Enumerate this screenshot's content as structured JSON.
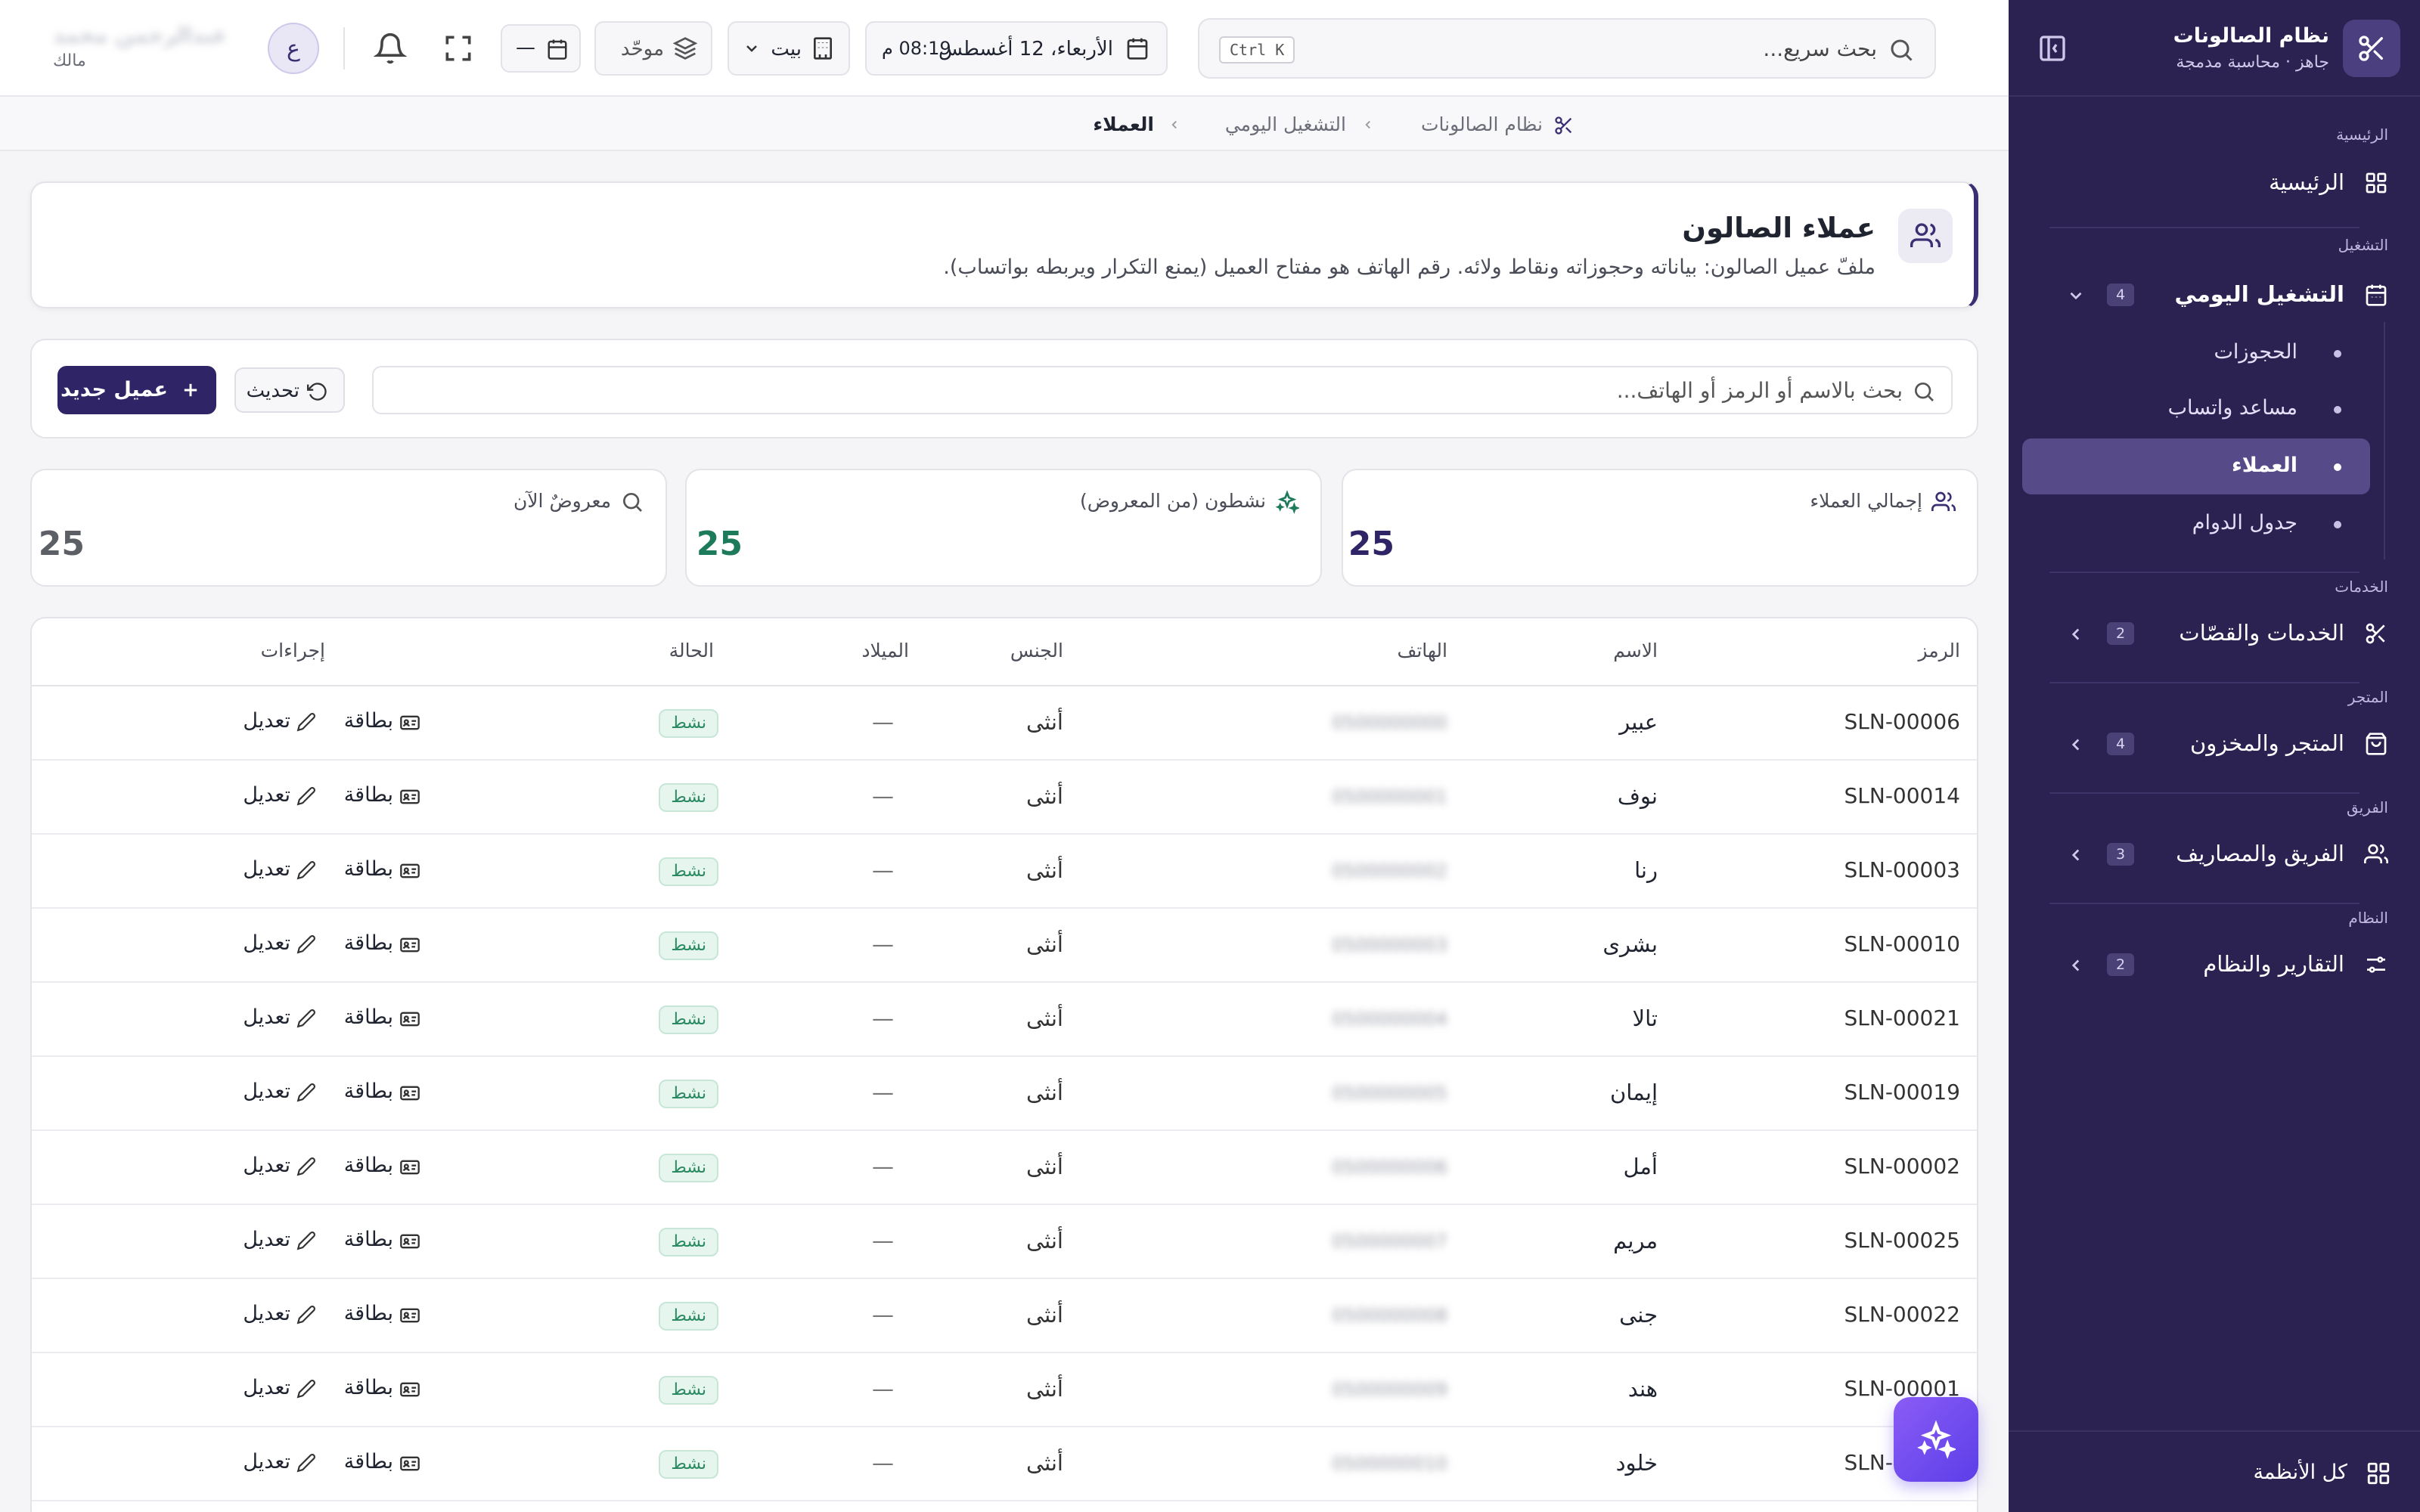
{
  "sidebar": {
    "app_title": "نظام الصالونات",
    "app_subtitle": "جاهز · محاسبة مدمجة",
    "sections": {
      "home": "الرئيسية",
      "ops": "التشغيل",
      "services": "الخدمات",
      "store": "المتجر",
      "team": "الفريق",
      "system": "النظام"
    },
    "items": {
      "home": "الرئيسية",
      "daily": "التشغيل اليومي",
      "daily_count": "4",
      "services": "الخدمات والقصّات",
      "services_count": "2",
      "store": "المتجر والمخزون",
      "store_count": "4",
      "team": "الفريق والمصاريف",
      "team_count": "3",
      "reports": "التقارير والنظام",
      "reports_count": "2"
    },
    "children": [
      "الحجوزات",
      "مساعد واتساب",
      "العملاء",
      "جدول الدوام"
    ],
    "footer": "كل الأنظمة"
  },
  "topbar": {
    "search_placeholder": "بحث سريع...",
    "shortcut": "Ctrl K",
    "date": "الأربعاء، 12 أغسطس",
    "time": "08:19 م",
    "branch": "بيت",
    "mode": "موحّد",
    "calendar_value": "—",
    "avatar_letter": "ع",
    "user_name": "عبدالرحمن محمد",
    "user_role": "مالك"
  },
  "breadcrumb": {
    "root": "نظام الصالونات",
    "section": "التشغيل اليومي",
    "current": "العملاء"
  },
  "page": {
    "title": "عملاء الصالون",
    "description": "ملفّ عميل الصالون: بياناته وحجوزاته ونقاط ولائه. رقم الهاتف هو مفتاح العميل (يمنع التكرار ويربطه بواتساب)."
  },
  "toolbar": {
    "search_placeholder": "بحث بالاسم أو الرمز أو الهاتف...",
    "refresh": "تحديث",
    "new_client": "عميل جديد"
  },
  "stats": {
    "total_label": "إجمالي العملاء",
    "total_value": "25",
    "active_label": "نشطون (من المعروض)",
    "active_value": "25",
    "shown_label": "معروضٌ الآن",
    "shown_value": "25"
  },
  "table": {
    "headers": {
      "code": "الرمز",
      "name": "الاسم",
      "phone": "الهاتف",
      "gender": "الجنس",
      "birth": "الميلاد",
      "status": "الحالة",
      "actions": "إجراءات"
    },
    "action_card": "بطاقة",
    "action_edit": "تعديل",
    "rows": [
      {
        "code": "SLN-00006",
        "name": "عبير",
        "phone": "0500000000",
        "gender": "أنثى",
        "birth": "—",
        "status": "نشط"
      },
      {
        "code": "SLN-00014",
        "name": "نوف",
        "phone": "0500000001",
        "gender": "أنثى",
        "birth": "—",
        "status": "نشط"
      },
      {
        "code": "SLN-00003",
        "name": "رنا",
        "phone": "0500000002",
        "gender": "أنثى",
        "birth": "—",
        "status": "نشط"
      },
      {
        "code": "SLN-00010",
        "name": "بشرى",
        "phone": "0500000003",
        "gender": "أنثى",
        "birth": "—",
        "status": "نشط"
      },
      {
        "code": "SLN-00021",
        "name": "تالا",
        "phone": "0500000004",
        "gender": "أنثى",
        "birth": "—",
        "status": "نشط"
      },
      {
        "code": "SLN-00019",
        "name": "إيمان",
        "phone": "0500000005",
        "gender": "أنثى",
        "birth": "—",
        "status": "نشط"
      },
      {
        "code": "SLN-00002",
        "name": "أمل",
        "phone": "0500000006",
        "gender": "أنثى",
        "birth": "—",
        "status": "نشط"
      },
      {
        "code": "SLN-00025",
        "name": "مريم",
        "phone": "0500000007",
        "gender": "أنثى",
        "birth": "—",
        "status": "نشط"
      },
      {
        "code": "SLN-00022",
        "name": "جنى",
        "phone": "0500000008",
        "gender": "أنثى",
        "birth": "—",
        "status": "نشط"
      },
      {
        "code": "SLN-00001",
        "name": "هند",
        "phone": "0500000009",
        "gender": "أنثى",
        "birth": "—",
        "status": "نشط"
      },
      {
        "code": "SLN-00007",
        "name": "خلود",
        "phone": "0500000010",
        "gender": "أنثى",
        "birth": "—",
        "status": "نشط"
      }
    ]
  },
  "colors": {
    "sidebar_bg": "#2b2251",
    "primary": "#2f2566",
    "active_green": "#1d7a5a",
    "fab_start": "#8b5cf6",
    "fab_end": "#5b3ee8"
  }
}
